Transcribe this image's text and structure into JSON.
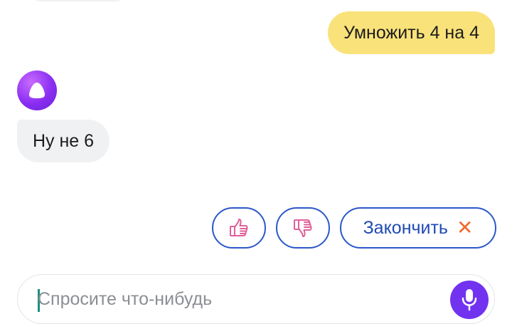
{
  "chat": {
    "user_message": "Умножить 4 на 4",
    "assistant_message": "Ну не 6"
  },
  "suggestions": {
    "like_icon": "thumbs-up-icon",
    "dislike_icon": "thumbs-down-icon",
    "finish_label": "Закончить",
    "finish_icon": "close-icon"
  },
  "input": {
    "placeholder": "Спросите что-нибудь",
    "value": ""
  },
  "colors": {
    "user_bubble": "#fae27a",
    "assistant_bubble": "#f0f1f3",
    "accent_blue": "#2b57c9",
    "mic_purple": "#7133f0",
    "avatar_purple": "#8a2ef2",
    "thumb_pink": "#e0609a",
    "close_orange": "#f26a2e"
  }
}
